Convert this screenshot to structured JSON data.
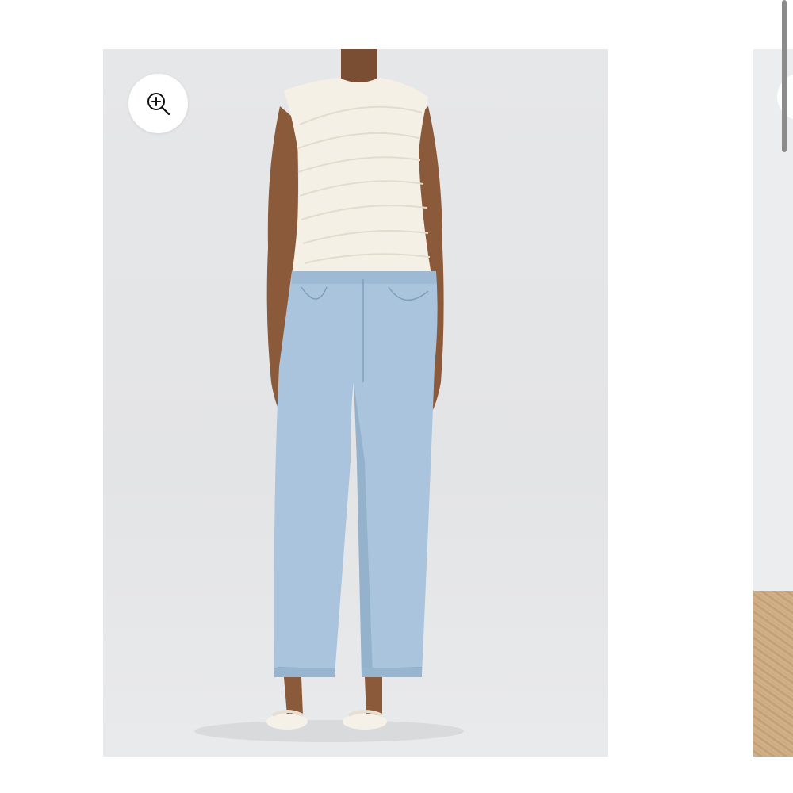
{
  "product_gallery": {
    "main_image": {
      "alt": "",
      "background_color": "#e5e6e8"
    },
    "zoom_button": {
      "icon": "zoom-in-icon"
    },
    "next_image": {
      "upper_color": "#ecedee",
      "lower_color": "#cdae86"
    }
  },
  "scrollbar": {
    "position_fraction": 0.0
  }
}
